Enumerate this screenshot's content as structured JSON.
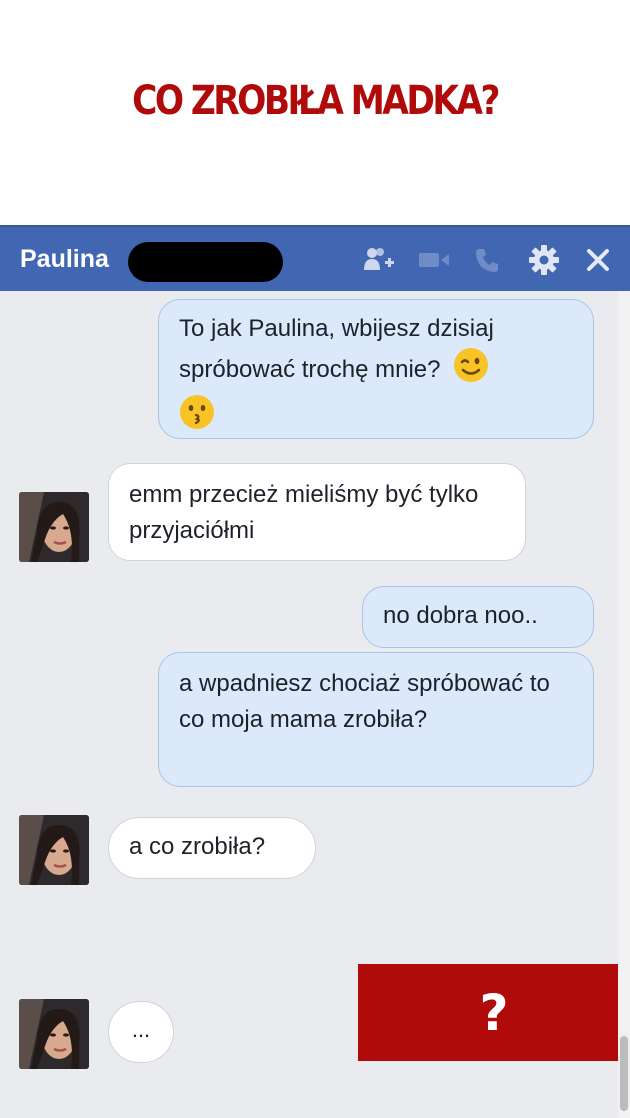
{
  "headline": "CO ZROBIŁA MADKA?",
  "chat": {
    "contact_name": "Paulina",
    "header_icons": [
      "add-friend-icon",
      "video-call-icon",
      "voice-call-icon",
      "gear-icon",
      "close-icon"
    ],
    "colors": {
      "header": "#4267b2",
      "outgoing_bubble": "#dbe9fb",
      "incoming_bubble": "#ffffff",
      "accent": "#b00a0a"
    },
    "messages": [
      {
        "direction": "outgoing",
        "text": "To jak Paulina, wbijesz dzisiaj spróbować trochę mnie?",
        "emojis": [
          "wink-emoji",
          "kiss-emoji"
        ]
      },
      {
        "direction": "incoming",
        "text": "emm przecież mieliśmy być tylko przyjaciółmi"
      },
      {
        "direction": "outgoing",
        "text": "no dobra noo.."
      },
      {
        "direction": "outgoing",
        "text": "a wpadniesz chociaż spróbować to co moja mama zrobiła?"
      },
      {
        "direction": "incoming",
        "text": "a co zrobiła?"
      },
      {
        "direction": "incoming",
        "text": "..."
      }
    ],
    "reveal_label": "?"
  }
}
